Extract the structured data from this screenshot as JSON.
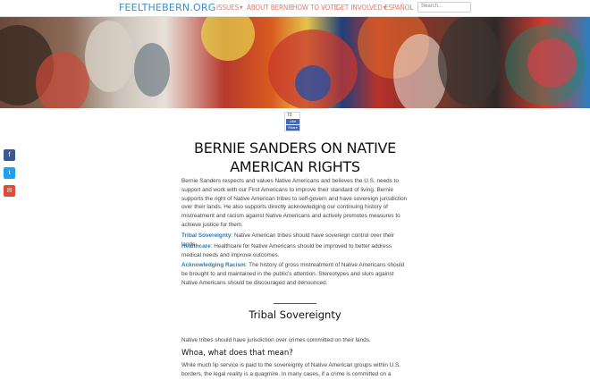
{
  "nav": {
    "logo": "FEELTHEBERN.ORG",
    "items": [
      {
        "label": "ISSUES",
        "dropdown": true
      },
      {
        "label": "ABOUT BERNIE",
        "dropdown": false
      },
      {
        "label": "HOW TO VOTE",
        "dropdown": false
      },
      {
        "label": "GET INVOLVED",
        "dropdown": true
      },
      {
        "label": "ESPAÑOL",
        "dropdown": false
      }
    ],
    "search_placeholder": "Search..."
  },
  "facebook_widget": {
    "count": "73",
    "like_label": "Like",
    "share_label": "Share"
  },
  "side_share": [
    {
      "icon": "facebook-icon",
      "glyph": "f",
      "color": "#3b5998"
    },
    {
      "icon": "twitter-icon",
      "glyph": "t",
      "color": "#1da1f2"
    },
    {
      "icon": "email-icon",
      "glyph": "✉",
      "color": "#dd4b39"
    }
  ],
  "article": {
    "title": "Bernie Sanders on Native American Rights",
    "intro": "Bernie Sanders respects and values Native Americans and believes the U.S. needs to support and work with our First Americans to improve their standard of living. Bernie supports the right of Native American tribes to self-govern and have sovereign jurisdiction over their lands. He also supports directly acknowledging our continuing history of mistreatment and racism against Native Americans and actively promotes measures to achieve justice for them.",
    "points": [
      {
        "term": "Tribal Sovereignty",
        "text": ": Native American tribes should have sovereign control over their lands."
      },
      {
        "term": "Healthcare",
        "text": ": Healthcare for Native Americans should be improved to better address medical needs and improve outcomes."
      },
      {
        "term": "Acknowledging Racism",
        "text": ": The history of gross mistreatment of Native Americans should be brought to and maintained in the public's attention. Stereotypes and slurs against Native Americans should be discouraged and denounced."
      }
    ],
    "section_title": "Tribal Sovereignty",
    "section_lead": "Native tribes should have jurisdiction over crimes committed on their lands.",
    "sub_heading": "Whoa, what does that mean?",
    "sub_text": "While much lip service is paid to the sovereignty of Native American groups within U.S. borders, the legal reality is a quagmire. In many cases, if a crime is committed on a"
  }
}
